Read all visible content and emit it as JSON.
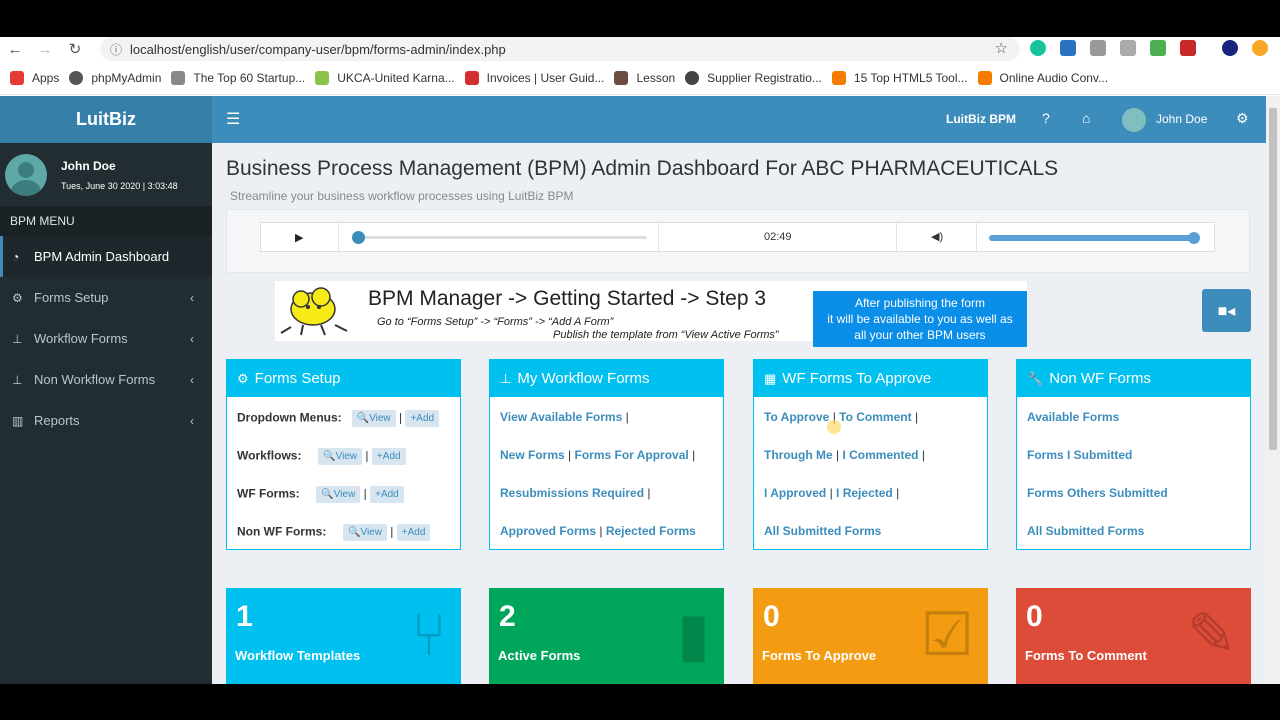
{
  "browser": {
    "url": "localhost/english/user/company-user/bpm/forms-admin/index.php",
    "bookmarks": [
      "Apps",
      "phpMyAdmin",
      "The Top 60 Startup...",
      "UKCA-United Karna...",
      "Invoices | User Guid...",
      "Lesson",
      "Supplier Registratio...",
      "15 Top HTML5 Tool...",
      "Online Audio Conv..."
    ]
  },
  "sidebar": {
    "logo": "LuitBiz",
    "user_name": "John Doe",
    "datetime": "Tues, June 30 2020 | 3:03:48",
    "menu_header": "BPM MENU",
    "items": [
      {
        "label": "BPM Admin Dashboard",
        "icon": "dashboard-icon"
      },
      {
        "label": "Forms Setup",
        "icon": "cogs-icon"
      },
      {
        "label": "Workflow Forms",
        "icon": "sitemap-icon"
      },
      {
        "label": "Non Workflow Forms",
        "icon": "sitemap-icon"
      },
      {
        "label": "Reports",
        "icon": "bar-chart-icon"
      }
    ]
  },
  "topbar": {
    "brand": "LuitBiz BPM",
    "user_name": "John Doe"
  },
  "page": {
    "title": "Business Process Management (BPM) Admin Dashboard For ABC PHARMACEUTICALS",
    "subtitle": "Streamline your business workflow processes using LuitBiz BPM"
  },
  "player": {
    "time": "02:49",
    "progress": 0.0,
    "volume": 1.0
  },
  "banner": {
    "title": "BPM Manager -> Getting Started -> Step 3",
    "line1": "Go to “Forms Setup” -> “Forms” -> “Add A Form”",
    "line2": "Publish the template from “View Active Forms”",
    "note1": "After publishing the form",
    "note2": "it will be available to you as well as",
    "note3": "all your other BPM users"
  },
  "boxes": {
    "forms_setup": {
      "title": "Forms Setup",
      "rows": [
        "Dropdown Menus:",
        "Workflows:",
        "WF Forms:",
        "Non WF Forms:"
      ],
      "view": "View",
      "add": "Add"
    },
    "my_workflow": {
      "title": "My Workflow Forms",
      "l1a": "View Available Forms",
      "l2a": "New Forms",
      "l2b": "Forms For Approval",
      "l3a": "Resubmissions Required",
      "l4a": "Approved Forms",
      "l4b": "Rejected Forms"
    },
    "wf_approve": {
      "title": "WF Forms To Approve",
      "l1a": "To Approve",
      "l1b": "To Comment",
      "l2a": "Through Me",
      "l2b": "I Commented",
      "l3a": "I Approved",
      "l3b": "I Rejected",
      "l4a": "All Submitted Forms"
    },
    "non_wf": {
      "title": "Non WF Forms",
      "l1": "Available Forms",
      "l2": "Forms I Submitted",
      "l3": "Forms Others Submitted",
      "l4": "All Submitted Forms"
    }
  },
  "tiles": [
    {
      "num": "1",
      "label": "Workflow Templates",
      "color": "#00c0ef"
    },
    {
      "num": "2",
      "label": "Active Forms",
      "color": "#00a65a"
    },
    {
      "num": "0",
      "label": "Forms To Approve",
      "color": "#f39c12"
    },
    {
      "num": "0",
      "label": "Forms To Comment",
      "color": "#dd4b39"
    }
  ]
}
